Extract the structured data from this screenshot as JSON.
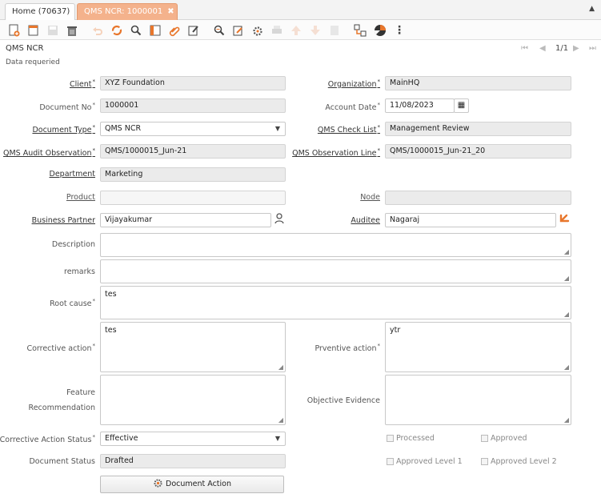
{
  "tabs": {
    "home": "Home (70637)",
    "active": "QMS NCR: 1000001",
    "close_glyph": "✖"
  },
  "window": {
    "title": "QMS NCR",
    "record_nav": "1/1",
    "status_text": "Data requeried"
  },
  "form": {
    "client": {
      "label": "Client",
      "value": "XYZ Foundation"
    },
    "organization": {
      "label": "Organization",
      "value": "MainHQ"
    },
    "document_no": {
      "label": "Document No",
      "value": "1000001"
    },
    "account_date": {
      "label": "Account Date",
      "value": "11/08/2023"
    },
    "document_type": {
      "label": "Document Type",
      "value": "QMS NCR"
    },
    "check_list": {
      "label": "QMS Check List",
      "value": "Management Review"
    },
    "audit_observation": {
      "label": "QMS Audit Observation",
      "value": "QMS/1000015_Jun-21"
    },
    "observation_line": {
      "label": "QMS Observation Line",
      "value": "QMS/1000015_Jun-21_20"
    },
    "department": {
      "label": "Department",
      "value": "Marketing"
    },
    "product": {
      "label": "Product",
      "value": ""
    },
    "node": {
      "label": "Node",
      "value": ""
    },
    "business_partner": {
      "label": "Business Partner",
      "value": "Vijayakumar"
    },
    "auditee": {
      "label": "Auditee",
      "value": "Nagaraj"
    },
    "description": {
      "label": "Description",
      "value": ""
    },
    "remarks": {
      "label": "remarks",
      "value": ""
    },
    "root_cause": {
      "label": "Root cause",
      "value": "tes"
    },
    "corrective_action": {
      "label": "Corrective action",
      "value": "tes"
    },
    "preventive_action": {
      "label": "Prventive action",
      "value": "ytr"
    },
    "feature_recommendation": {
      "label_line1": "Feature",
      "label_line2": "Recommendation",
      "value": ""
    },
    "objective_evidence": {
      "label": "Objective Evidence",
      "value": ""
    },
    "corrective_action_status": {
      "label": "Corrective Action Status",
      "value": "Effective"
    },
    "document_status": {
      "label": "Document Status",
      "value": "Drafted"
    },
    "processed": {
      "label": "Processed",
      "checked": false
    },
    "approved": {
      "label": "Approved",
      "checked": false
    },
    "approved_level1": {
      "label": "Approved Level 1",
      "checked": false
    },
    "approved_level2": {
      "label": "Approved Level 2",
      "checked": false
    },
    "document_action_button": "Document Action"
  },
  "colors": {
    "active_tab": "#f4b28c",
    "readonly_field": "#ebebeb",
    "zoom_icon": "#e8762b"
  }
}
